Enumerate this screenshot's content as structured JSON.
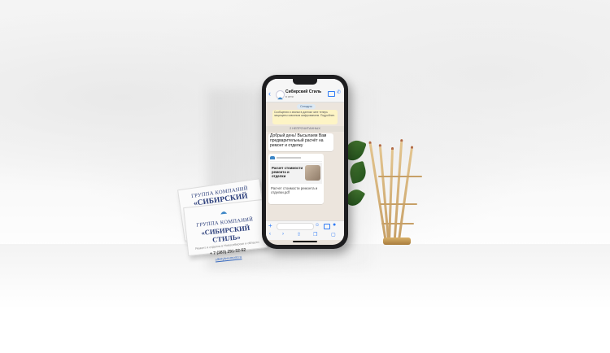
{
  "card": {
    "line1": "ГРУППА КОМПАНИЙ",
    "line2": "«СИБИРСКИЙ СТИЛЬ»",
    "line3": "Ремонт и отделка в Новосибирске и области",
    "phone": "+ 7 (383) 291-52-52",
    "site": "sibstyleremont.ru"
  },
  "phone": {
    "status_time": "11:52",
    "chat_name": "Сибирский Стиль",
    "chat_sub": "в сети",
    "today_chip": "Сегодня",
    "encryption_note": "Сообщения и звонки в данном чате теперь защищены сквозным шифрованием. Подробнее.",
    "unread_label": "2 НЕПРОЧИТАННЫХ",
    "message1": "Добрый день! Высылаем Вам предварительный расчёт на ремонт и отделку",
    "doc_title": "Расчет стоимости ремонта и отделки",
    "doc_filename": "Расчет стоимости ремонта и отделки.pdf"
  },
  "icons": [
    "back-icon",
    "video-icon",
    "call-icon",
    "plus-icon",
    "sticker-icon",
    "camera-icon",
    "mic-icon",
    "nav-back-icon",
    "nav-forward-icon",
    "share-icon",
    "bookmarks-icon",
    "tabs-icon"
  ],
  "colors": {
    "accent": "#2f7bf5",
    "card_text": "#2a3d7a",
    "chat_bg": "#ece5dd",
    "enc_bg": "#fdf4c5"
  }
}
